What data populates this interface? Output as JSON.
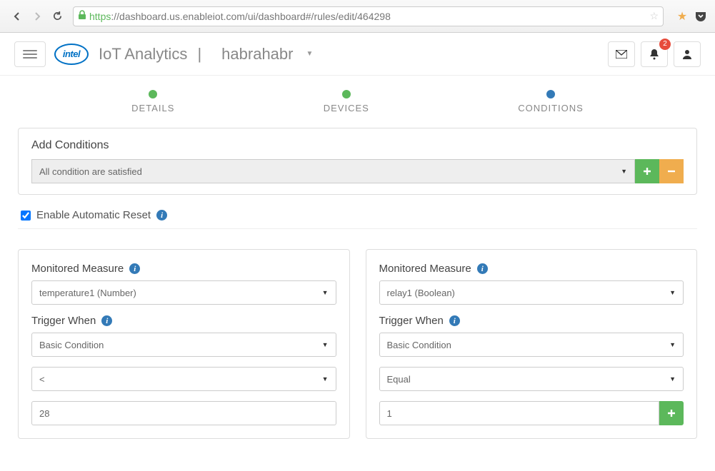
{
  "browser": {
    "url_proto": "https",
    "url_rest": "://dashboard.us.enableiot.com/ui/dashboard#/rules/edit/464298"
  },
  "header": {
    "brand": "IoT Analytics",
    "divider": "|",
    "account": "habrahabr",
    "notif_count": "2"
  },
  "wizard": {
    "steps": [
      {
        "label": "DETAILS",
        "state": "done"
      },
      {
        "label": "DEVICES",
        "state": "done"
      },
      {
        "label": "CONDITIONS",
        "state": "active"
      }
    ]
  },
  "conditions": {
    "panel_title": "Add Conditions",
    "mode": "All condition are satisfied",
    "auto_reset_label": "Enable Automatic Reset",
    "auto_reset_checked": true
  },
  "labels": {
    "monitored_measure": "Monitored Measure",
    "trigger_when": "Trigger When"
  },
  "panels": [
    {
      "measure": "temperature1 (Number)",
      "trigger_type": "Basic Condition",
      "operator": "<",
      "value": "28",
      "has_add": false
    },
    {
      "measure": "relay1 (Boolean)",
      "trigger_type": "Basic Condition",
      "operator": "Equal",
      "value": "1",
      "has_add": true
    }
  ]
}
